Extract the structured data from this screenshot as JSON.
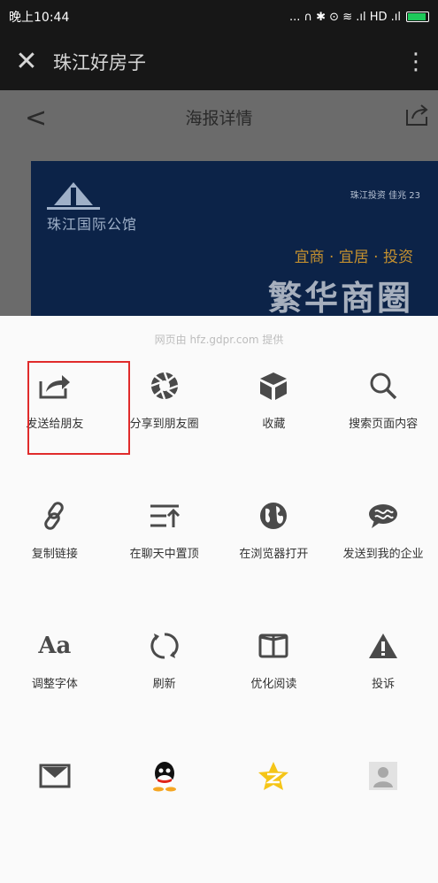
{
  "status_bar": {
    "time": "晚上10:44",
    "indicators": "... ∩ ✱ ⊙ ≋ .ıl HD .ıl"
  },
  "top_bar": {
    "close_icon": "close-icon",
    "title": "珠江好房子",
    "more_icon": "more-vertical-icon"
  },
  "page": {
    "nav_title": "海报详情",
    "banner": {
      "logo_text": "珠江国际公馆",
      "brands": "珠江投资 佳兆 23",
      "slogan": "宜商 · 宜居 · 投资",
      "headline": "繁华商圈"
    }
  },
  "share_sheet": {
    "provider": "网页由 hfz.gdpr.com 提供",
    "rows": [
      [
        {
          "label": "发送给朋友",
          "icon": "send-to-friend-icon"
        },
        {
          "label": "分享到朋友圈",
          "icon": "moments-icon"
        },
        {
          "label": "收藏",
          "icon": "favorite-cube-icon"
        },
        {
          "label": "搜索页面内容",
          "icon": "search-icon"
        }
      ],
      [
        {
          "label": "复制链接",
          "icon": "link-icon"
        },
        {
          "label": "在聊天中置顶",
          "icon": "pin-to-top-icon"
        },
        {
          "label": "在浏览器打开",
          "icon": "browser-globe-icon"
        },
        {
          "label": "发送到我的企业",
          "icon": "enterprise-chat-icon"
        }
      ],
      [
        {
          "label": "调整字体",
          "icon": "font-size-icon"
        },
        {
          "label": "刷新",
          "icon": "refresh-icon"
        },
        {
          "label": "优化阅读",
          "icon": "reader-book-icon"
        },
        {
          "label": "投诉",
          "icon": "warning-icon"
        }
      ],
      [
        {
          "label": "",
          "icon": "mail-icon"
        },
        {
          "label": "",
          "icon": "qq-icon"
        },
        {
          "label": "",
          "icon": "qzone-star-icon"
        },
        {
          "label": "",
          "icon": "contact-avatar-icon"
        }
      ]
    ]
  },
  "colors": {
    "highlight": "#e02b2b",
    "icon": "#4a4a4a",
    "qzone": "#f5c518"
  }
}
